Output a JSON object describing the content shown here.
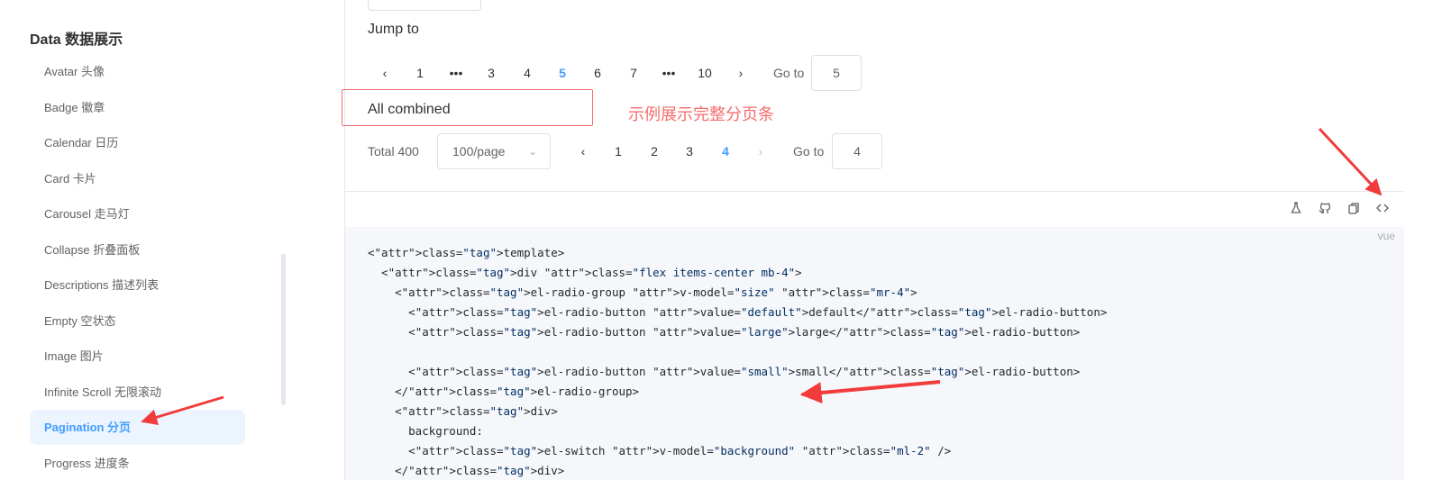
{
  "sidebar": {
    "group_title": "Data 数据展示",
    "items": [
      {
        "label": "Avatar 头像"
      },
      {
        "label": "Badge 徽章"
      },
      {
        "label": "Calendar 日历"
      },
      {
        "label": "Card 卡片"
      },
      {
        "label": "Carousel 走马灯"
      },
      {
        "label": "Collapse 折叠面板"
      },
      {
        "label": "Descriptions 描述列表"
      },
      {
        "label": "Empty 空状态"
      },
      {
        "label": "Image 图片"
      },
      {
        "label": "Infinite Scroll 无限滚动"
      },
      {
        "label": "Pagination 分页"
      },
      {
        "label": "Progress 进度条"
      }
    ],
    "active_index": 10
  },
  "demo": {
    "jump_to_label": "Jump to",
    "jump_pager": {
      "prev": "‹",
      "pages": [
        "1",
        "•••",
        "3",
        "4",
        "5",
        "6",
        "7",
        "•••",
        "10"
      ],
      "active": "5",
      "next": "›",
      "goto_label": "Go to",
      "goto_value": "5"
    },
    "all_combined_label": "All combined",
    "annotation": "示例展示完整分页条",
    "combined_pager": {
      "total": "Total 400",
      "page_size": "100/page",
      "prev": "‹",
      "pages": [
        "1",
        "2",
        "3",
        "4"
      ],
      "active": "4",
      "next": "›",
      "goto_label": "Go to",
      "goto_value": "4"
    }
  },
  "toolbar": {
    "icons": [
      "flask-icon",
      "github-icon",
      "copy-icon",
      "code-icon"
    ]
  },
  "code": {
    "lang": "vue",
    "lines": [
      "<template>",
      "  <div class=\"flex items-center mb-4\">",
      "    <el-radio-group v-model=\"size\" class=\"mr-4\">",
      "      <el-radio-button value=\"default\">default</el-radio-button>",
      "      <el-radio-button value=\"large\">large</el-radio-button>",
      "",
      "      <el-radio-button value=\"small\">small</el-radio-button>",
      "    </el-radio-group>",
      "    <div>",
      "      background:",
      "      <el-switch v-model=\"background\" class=\"ml-2\" />",
      "    </div>"
    ]
  },
  "colors": {
    "accent": "#409eff",
    "annotation_red": "#f56c6c"
  }
}
